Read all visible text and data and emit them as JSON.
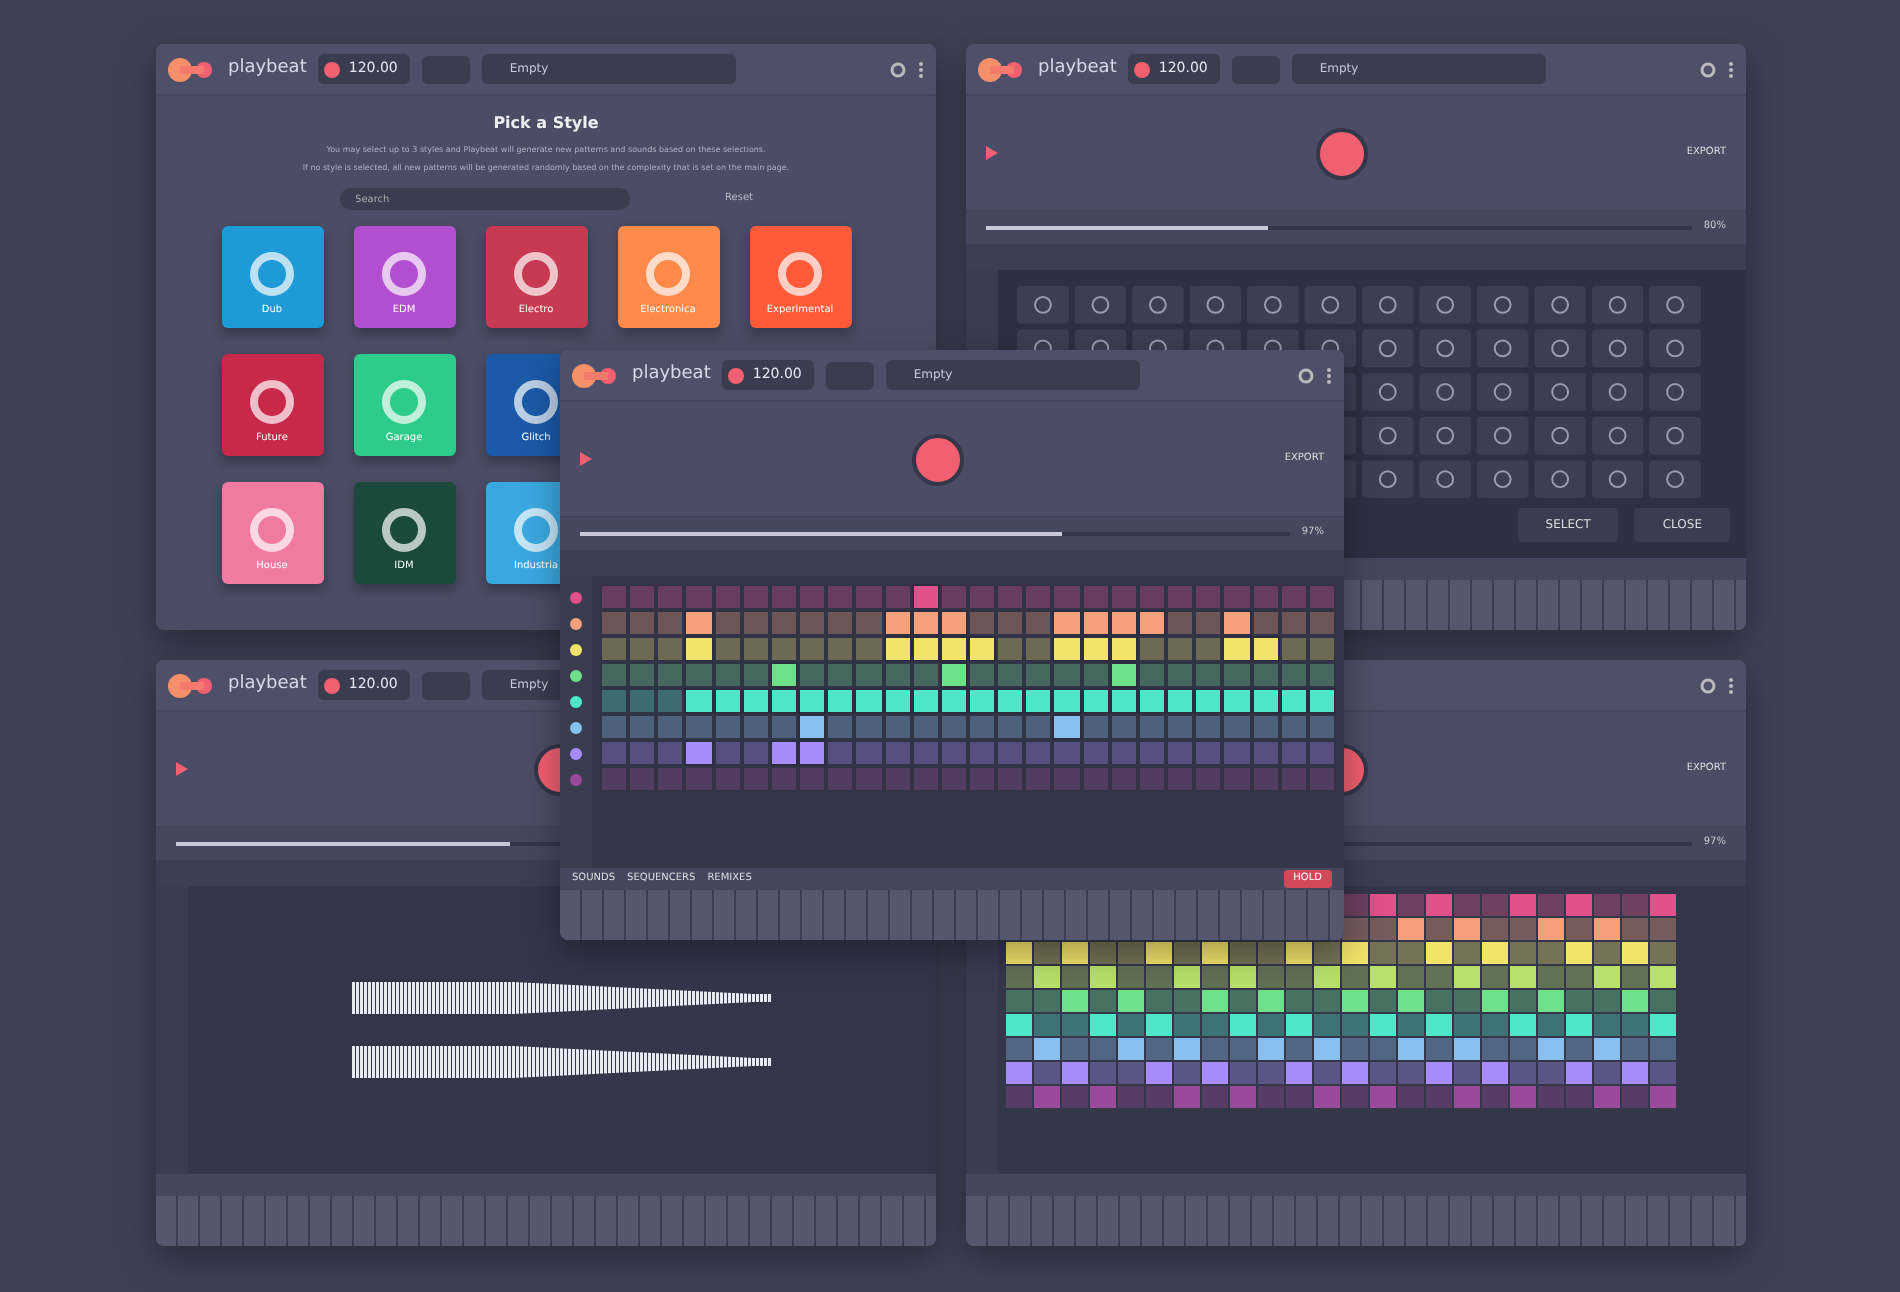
{
  "windows": [
    {
      "kind": "style-picker",
      "app_name": "playbeat",
      "tempo": "120.00",
      "preset": "Empty",
      "header_icons": true,
      "title": "Pick a Style",
      "description": [
        "You may select up to 3 styles and Playbeat will generate new patterns and sounds based on these selections.",
        "If no style is selected, all new patterns will be generated randomly based on the complexity that is set on the main page."
      ],
      "search": {
        "placeholder": "Search"
      },
      "reset": "Reset",
      "style_rows": [
        [
          {
            "label": "Dub",
            "color": "#1e9ad6"
          },
          {
            "label": "EDM",
            "color": "#b24fd0"
          },
          {
            "label": "Electro",
            "color": "#c83a52"
          },
          {
            "label": "Electronica",
            "color": "#ff8a4a"
          },
          {
            "label": "Experimental",
            "color": "#ff5a3a"
          }
        ],
        [
          {
            "label": "Future",
            "color": "#c8284a"
          },
          {
            "label": "Garage",
            "color": "#2ecc8a"
          },
          {
            "label": "Glitch",
            "color": "#1a5aa8"
          }
        ],
        [
          {
            "label": "House",
            "color": "#f07aa0"
          },
          {
            "label": "IDM",
            "color": "#1a4a3a"
          },
          {
            "label": "Industria",
            "color": "#3aa8e0"
          }
        ]
      ]
    },
    {
      "kind": "icon-picker",
      "app_name": "playbeat",
      "tempo": "120.00",
      "preset": "Empty",
      "header_icons": true,
      "export": "EXPORT",
      "slider": {
        "level": 0.4,
        "reading": "80%"
      },
      "buttons": [
        "SELECT",
        "CLOSE"
      ]
    },
    {
      "kind": "sample-editor",
      "app_name": "playbeat",
      "tempo": "120.00",
      "preset": "Empty",
      "slider": {
        "level": 0.45
      }
    },
    {
      "kind": "note-grid",
      "header_icons": true,
      "export": "EXPORT",
      "slider": {
        "level": 0.45,
        "reading": "97%"
      }
    }
  ],
  "front_window": {
    "app_name": "playbeat",
    "tempo": "120.00",
    "preset": "Empty",
    "header_icons": true,
    "export": "EXPORT",
    "slider": {
      "level": 0.68,
      "reading": "97%"
    },
    "tracks": [
      {
        "color": "#e0508a",
        "steps": [
          false,
          false,
          false,
          false,
          false,
          false,
          false,
          false,
          false,
          false,
          false,
          true,
          false,
          false,
          false,
          false,
          false,
          false,
          false,
          false,
          false,
          false,
          false,
          false,
          false,
          false
        ]
      },
      {
        "color": "#f4a07a",
        "steps": [
          false,
          false,
          false,
          true,
          false,
          false,
          false,
          false,
          false,
          false,
          true,
          true,
          true,
          false,
          false,
          false,
          true,
          true,
          true,
          true,
          false,
          false,
          true,
          false,
          false,
          false
        ]
      },
      {
        "color": "#f2e36a",
        "steps": [
          false,
          false,
          false,
          true,
          false,
          false,
          false,
          false,
          false,
          false,
          true,
          true,
          true,
          true,
          false,
          false,
          true,
          true,
          true,
          false,
          false,
          false,
          true,
          true,
          false,
          false
        ]
      },
      {
        "color": "#6ee08a",
        "steps": [
          false,
          false,
          false,
          false,
          false,
          false,
          true,
          false,
          false,
          false,
          false,
          false,
          true,
          false,
          false,
          false,
          false,
          false,
          true,
          false,
          false,
          false,
          false,
          false,
          false,
          false
        ]
      },
      {
        "color": "#4ee8c8",
        "steps": [
          false,
          false,
          false,
          true,
          true,
          true,
          true,
          true,
          true,
          true,
          true,
          true,
          true,
          true,
          true,
          true,
          true,
          true,
          true,
          true,
          true,
          true,
          true,
          true,
          true,
          true
        ]
      },
      {
        "color": "#88c0f0",
        "steps": [
          false,
          false,
          false,
          false,
          false,
          false,
          false,
          true,
          false,
          false,
          false,
          false,
          false,
          false,
          false,
          false,
          true,
          false,
          false,
          false,
          false,
          false,
          false,
          false,
          false,
          false
        ]
      },
      {
        "color": "#a78bfa",
        "steps": [
          false,
          false,
          false,
          true,
          false,
          false,
          true,
          true,
          false,
          false,
          false,
          false,
          false,
          false,
          false,
          false,
          false,
          false,
          false,
          false,
          false,
          false,
          false,
          false,
          false,
          false
        ]
      },
      {
        "color": "#9a4a9a",
        "steps": [
          false,
          false,
          false,
          false,
          false,
          false,
          false,
          false,
          false,
          false,
          false,
          false,
          false,
          false,
          false,
          false,
          false,
          false,
          false,
          false,
          false,
          false,
          false,
          false,
          false,
          false
        ]
      }
    ],
    "sections": [
      "SOUNDS",
      "SEQUENCERS",
      "REMIXES"
    ],
    "hold": "HOLD"
  }
}
